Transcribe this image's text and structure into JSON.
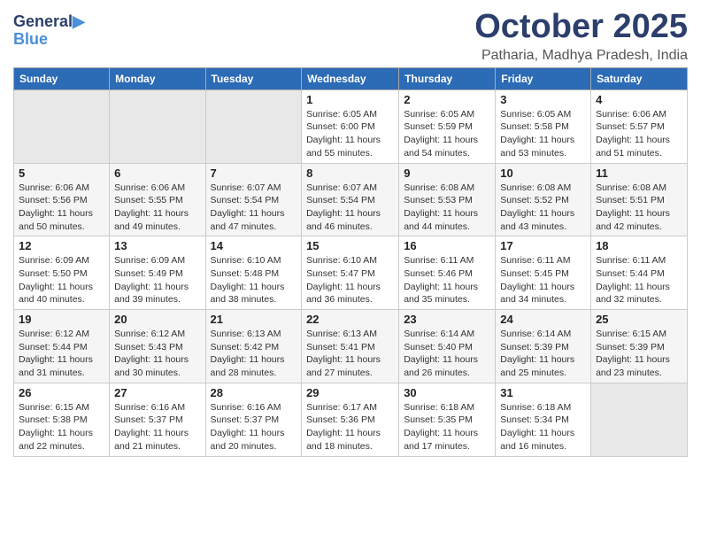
{
  "logo": {
    "line1": "General",
    "line2": "Blue"
  },
  "title": "October 2025",
  "location": "Patharia, Madhya Pradesh, India",
  "weekdays": [
    "Sunday",
    "Monday",
    "Tuesday",
    "Wednesday",
    "Thursday",
    "Friday",
    "Saturday"
  ],
  "weeks": [
    [
      {
        "day": "",
        "info": ""
      },
      {
        "day": "",
        "info": ""
      },
      {
        "day": "",
        "info": ""
      },
      {
        "day": "1",
        "info": "Sunrise: 6:05 AM\nSunset: 6:00 PM\nDaylight: 11 hours\nand 55 minutes."
      },
      {
        "day": "2",
        "info": "Sunrise: 6:05 AM\nSunset: 5:59 PM\nDaylight: 11 hours\nand 54 minutes."
      },
      {
        "day": "3",
        "info": "Sunrise: 6:05 AM\nSunset: 5:58 PM\nDaylight: 11 hours\nand 53 minutes."
      },
      {
        "day": "4",
        "info": "Sunrise: 6:06 AM\nSunset: 5:57 PM\nDaylight: 11 hours\nand 51 minutes."
      }
    ],
    [
      {
        "day": "5",
        "info": "Sunrise: 6:06 AM\nSunset: 5:56 PM\nDaylight: 11 hours\nand 50 minutes."
      },
      {
        "day": "6",
        "info": "Sunrise: 6:06 AM\nSunset: 5:55 PM\nDaylight: 11 hours\nand 49 minutes."
      },
      {
        "day": "7",
        "info": "Sunrise: 6:07 AM\nSunset: 5:54 PM\nDaylight: 11 hours\nand 47 minutes."
      },
      {
        "day": "8",
        "info": "Sunrise: 6:07 AM\nSunset: 5:54 PM\nDaylight: 11 hours\nand 46 minutes."
      },
      {
        "day": "9",
        "info": "Sunrise: 6:08 AM\nSunset: 5:53 PM\nDaylight: 11 hours\nand 44 minutes."
      },
      {
        "day": "10",
        "info": "Sunrise: 6:08 AM\nSunset: 5:52 PM\nDaylight: 11 hours\nand 43 minutes."
      },
      {
        "day": "11",
        "info": "Sunrise: 6:08 AM\nSunset: 5:51 PM\nDaylight: 11 hours\nand 42 minutes."
      }
    ],
    [
      {
        "day": "12",
        "info": "Sunrise: 6:09 AM\nSunset: 5:50 PM\nDaylight: 11 hours\nand 40 minutes."
      },
      {
        "day": "13",
        "info": "Sunrise: 6:09 AM\nSunset: 5:49 PM\nDaylight: 11 hours\nand 39 minutes."
      },
      {
        "day": "14",
        "info": "Sunrise: 6:10 AM\nSunset: 5:48 PM\nDaylight: 11 hours\nand 38 minutes."
      },
      {
        "day": "15",
        "info": "Sunrise: 6:10 AM\nSunset: 5:47 PM\nDaylight: 11 hours\nand 36 minutes."
      },
      {
        "day": "16",
        "info": "Sunrise: 6:11 AM\nSunset: 5:46 PM\nDaylight: 11 hours\nand 35 minutes."
      },
      {
        "day": "17",
        "info": "Sunrise: 6:11 AM\nSunset: 5:45 PM\nDaylight: 11 hours\nand 34 minutes."
      },
      {
        "day": "18",
        "info": "Sunrise: 6:11 AM\nSunset: 5:44 PM\nDaylight: 11 hours\nand 32 minutes."
      }
    ],
    [
      {
        "day": "19",
        "info": "Sunrise: 6:12 AM\nSunset: 5:44 PM\nDaylight: 11 hours\nand 31 minutes."
      },
      {
        "day": "20",
        "info": "Sunrise: 6:12 AM\nSunset: 5:43 PM\nDaylight: 11 hours\nand 30 minutes."
      },
      {
        "day": "21",
        "info": "Sunrise: 6:13 AM\nSunset: 5:42 PM\nDaylight: 11 hours\nand 28 minutes."
      },
      {
        "day": "22",
        "info": "Sunrise: 6:13 AM\nSunset: 5:41 PM\nDaylight: 11 hours\nand 27 minutes."
      },
      {
        "day": "23",
        "info": "Sunrise: 6:14 AM\nSunset: 5:40 PM\nDaylight: 11 hours\nand 26 minutes."
      },
      {
        "day": "24",
        "info": "Sunrise: 6:14 AM\nSunset: 5:39 PM\nDaylight: 11 hours\nand 25 minutes."
      },
      {
        "day": "25",
        "info": "Sunrise: 6:15 AM\nSunset: 5:39 PM\nDaylight: 11 hours\nand 23 minutes."
      }
    ],
    [
      {
        "day": "26",
        "info": "Sunrise: 6:15 AM\nSunset: 5:38 PM\nDaylight: 11 hours\nand 22 minutes."
      },
      {
        "day": "27",
        "info": "Sunrise: 6:16 AM\nSunset: 5:37 PM\nDaylight: 11 hours\nand 21 minutes."
      },
      {
        "day": "28",
        "info": "Sunrise: 6:16 AM\nSunset: 5:37 PM\nDaylight: 11 hours\nand 20 minutes."
      },
      {
        "day": "29",
        "info": "Sunrise: 6:17 AM\nSunset: 5:36 PM\nDaylight: 11 hours\nand 18 minutes."
      },
      {
        "day": "30",
        "info": "Sunrise: 6:18 AM\nSunset: 5:35 PM\nDaylight: 11 hours\nand 17 minutes."
      },
      {
        "day": "31",
        "info": "Sunrise: 6:18 AM\nSunset: 5:34 PM\nDaylight: 11 hours\nand 16 minutes."
      },
      {
        "day": "",
        "info": ""
      }
    ]
  ]
}
